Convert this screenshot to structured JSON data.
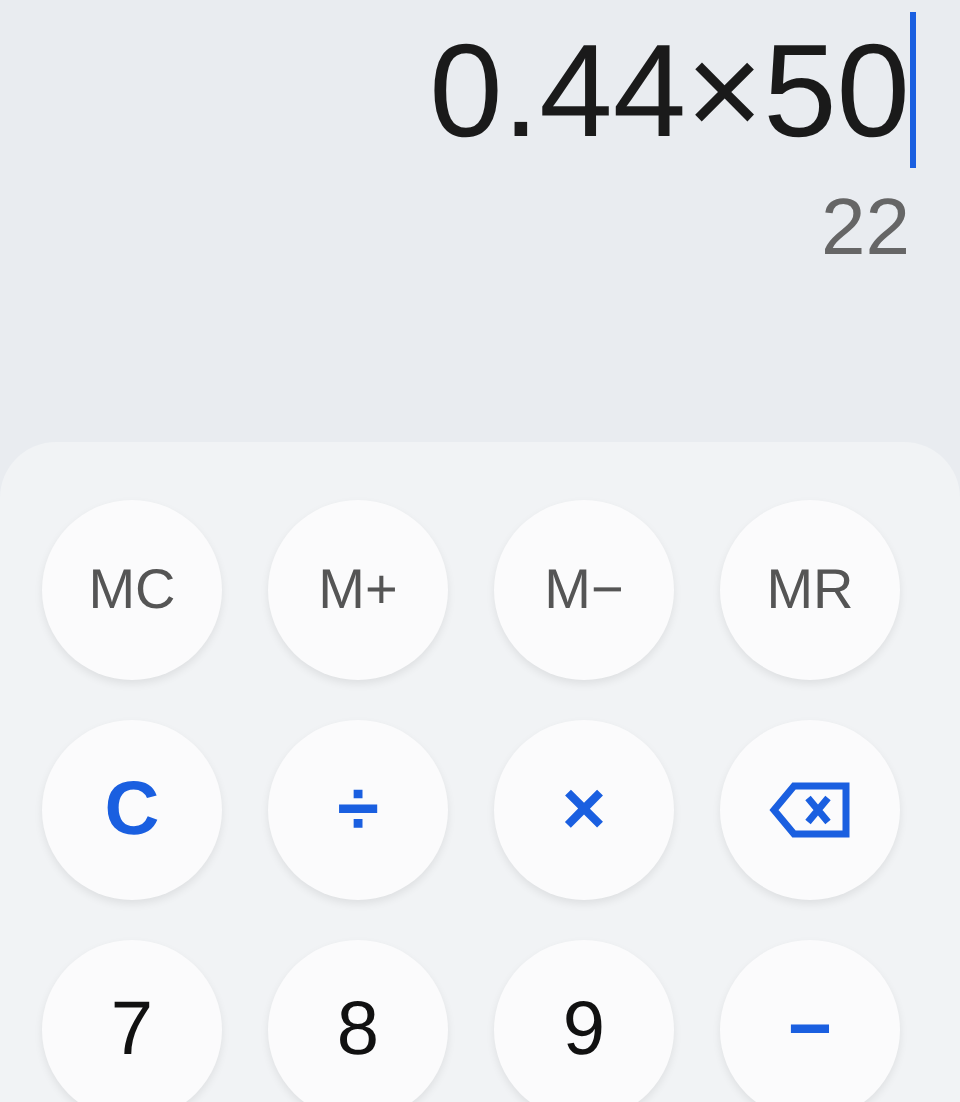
{
  "display": {
    "expression": "0.44×50",
    "result": "22"
  },
  "keys": [
    {
      "kind": "memory",
      "label": "MC"
    },
    {
      "kind": "memory",
      "label": "M+"
    },
    {
      "kind": "memory",
      "label": "M−"
    },
    {
      "kind": "memory",
      "label": "MR"
    },
    {
      "kind": "operator",
      "label": "C"
    },
    {
      "kind": "operator",
      "label": "÷"
    },
    {
      "kind": "operator",
      "label": "×"
    },
    {
      "kind": "backspace"
    },
    {
      "kind": "digit",
      "label": "7"
    },
    {
      "kind": "digit",
      "label": "8"
    },
    {
      "kind": "digit",
      "label": "9"
    },
    {
      "kind": "operator",
      "label": "−"
    }
  ]
}
